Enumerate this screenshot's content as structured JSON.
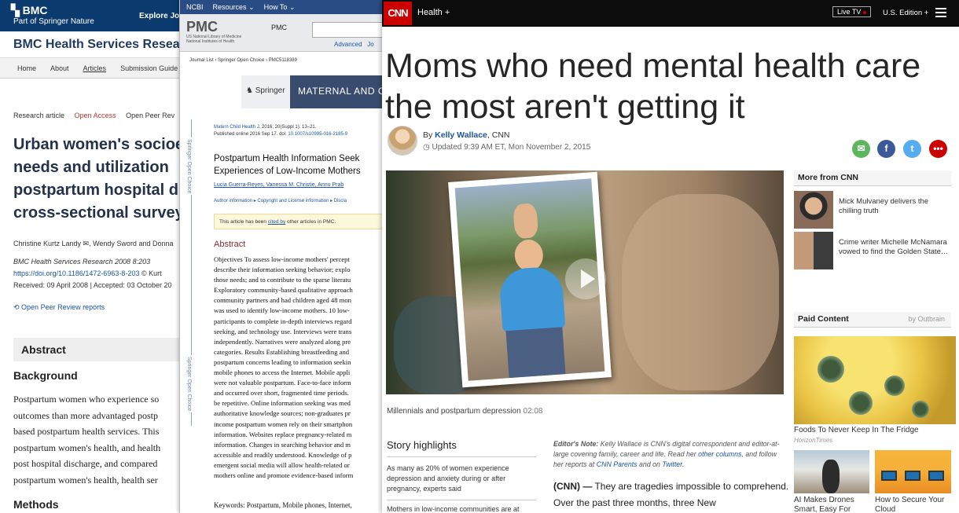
{
  "bmc": {
    "logo": "BMC",
    "logo_sub": "Part of Springer Nature",
    "explore": "Explore Jour",
    "journal": "BMC Health Services Resea",
    "nav": [
      "Home",
      "About",
      "Articles",
      "Submission Guide"
    ],
    "meta": {
      "type": "Research article",
      "open_access": "Open Access",
      "peer": "Open Peer Rev"
    },
    "title_lines": [
      "Urban women's socioe",
      "needs and utilization",
      "postpartum hospital d",
      "cross-sectional survey"
    ],
    "authors": "Christine Kurtz Landy ✉, Wendy Sword and Donna",
    "citation": "BMC Health Services Research 2008 8:203",
    "doi": "https://doi.org/10.1186/1472-6963-8-203",
    "doi_tail": "© Kurt",
    "received": "Received: 09 April 2008",
    "accepted": "Accepted: 03 October 20",
    "peer_reports": "Open Peer Review reports",
    "abstract_heading": "Abstract",
    "background_heading": "Background",
    "background_lines": [
      "Postpartum women who experience so",
      "outcomes than more advantaged postp",
      "based postpartum health services. This",
      "postpartum women's health, and health",
      "post hospital discharge, and compared",
      "postpartum women's health, health ser"
    ],
    "methods_heading": "Methods"
  },
  "pmc": {
    "ncbi": "NCBI",
    "resources": "Resources ⌄",
    "howto": "How To ⌄",
    "logo": "PMC",
    "logo_sub1": "US National Library of Medicine",
    "logo_sub2": "National Institutes of Health",
    "db": "PMC",
    "advanced": "Advanced",
    "jo": "Jo",
    "crumb": "Journal List › Springer Open Choice › PMC5118389",
    "banner_springer": "Springer",
    "banner_title": "MATERNAL AND C",
    "side_label": "Springer Open Choice",
    "cite_journal": "Matern Child Health J.",
    "cite_rest": " 2016; 20(Suppl 1): 13–21.",
    "published": "Published online 2016 Sep 17. doi: ",
    "doi": "10.1007/s10995-016-2185-9",
    "title_lines": [
      "Postpartum Health Information Seek",
      "Experiences of Low-Income Mothers"
    ],
    "authors": "Lucia Guerra-Reyes, Vanessa M. Christie, Annu Prab",
    "author_info": "Author information ▸  Copyright and License information ▸  Discla",
    "cited_prefix": "This article has been ",
    "cited_link": "cited by",
    "cited_suffix": " other articles in PMC.",
    "abstract_heading": "Abstract",
    "abstract_lines": [
      "Objectives To assess low-income mothers' percept",
      "describe their information seeking behavior; explo",
      "those needs; and to contribute to the sparse literatu",
      "Exploratory community-based qualitative approach",
      "community partners and had children aged 48 mon",
      "was used to identify low-income mothers. 10 low-",
      "participants to complete in-depth interviews regard",
      "seeking, and technology use. Interviews were trans",
      "independently. Narratives were analyzed along pre",
      "categories. Results Establishing breastfeeding and",
      "postpartum concerns leading to information seekin",
      "mobile phones to access the Internet. Mobile appli",
      "were not valuable postpartum. Face-to-face inform",
      "and occurred over short, fragmented time periods.",
      "be repetitive. Online information seeking was med",
      "authoritative knowledge sources; non-graduates pr",
      "income postpartum women rely on their smartphon",
      "information. Websites replace pregnancy-related m",
      "information. Changes in searching behavior and m",
      "accessible and readily understood. Knowledge of p",
      "emergent social media will allow health-related or",
      "mothers online and promote evidence-based inform"
    ],
    "keywords": "Keywords: Postpartum, Mobile phones, Internet,"
  },
  "cnn": {
    "logo": "CNN",
    "section": "Health +",
    "live_tv": "Live TV",
    "edition": "U.S. Edition +",
    "headline_lines": [
      "Moms who need mental health care",
      "the most aren't getting it"
    ],
    "by": "By ",
    "author": "Kelly Wallace",
    "outlet": ", CNN",
    "updated": "Updated 9:39 AM ET, Mon November 2, 2015",
    "video_title": "Millennials and postpartum depression",
    "video_duration": "02:08",
    "highlights_heading": "Story highlights",
    "highlight_1": "As many as 20% of women experience depression and anxiety during or after pregnancy, experts said",
    "highlight_2": "Mothers in low-income communities are at",
    "editor_label": "Editor's Note:",
    "editor_text1": " Kelly Wallace is CNN's digital correspondent and editor-at-large covering family, career and life. Read her ",
    "editor_link1": "other columns",
    "editor_text2": ", and follow her reports at ",
    "editor_link2": "CNN Parents",
    "editor_text3": " and on ",
    "editor_link3": "Twitter",
    "editor_text4": ".",
    "body_lead": "(CNN) —",
    "body_text": " They are tragedies impossible to comprehend. Over the past three months, three New",
    "more_heading": "More from CNN",
    "more_1": "Mick Mulvaney delivers the chilling truth",
    "more_2": "Crime writer Michelle McNamara vowed to find the Golden State…",
    "paid_heading": "Paid Content",
    "outbrain": "by Outbrain",
    "paid_1": "Foods To Never Keep In The Fridge",
    "paid_1_source": "HorizonTimes",
    "paid_2": "AI Makes Drones Smart, Easy For",
    "paid_3": "How to Secure Your Cloud",
    "colors": {
      "brand_red": "#cc0000",
      "link_blue": "#1a56a8",
      "email": "#5db55d",
      "facebook": "#3b5998",
      "twitter": "#55acee",
      "more": "#cc0000"
    }
  }
}
